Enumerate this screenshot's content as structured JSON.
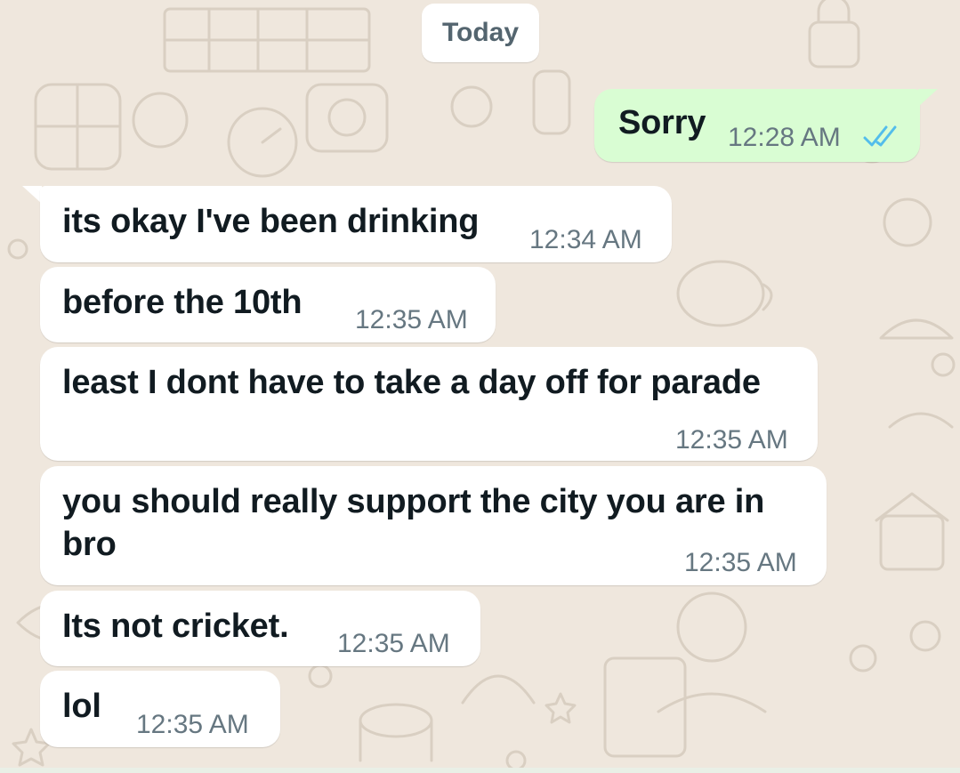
{
  "chat": {
    "date_chip": "Today",
    "messages": [
      {
        "direction": "outgoing",
        "text": "Sorry",
        "time": "12:28 AM",
        "status_icon": "double-check-read-icon"
      },
      {
        "direction": "incoming",
        "text": "its okay I've been drinking",
        "time": "12:34 AM"
      },
      {
        "direction": "incoming",
        "text": "before the 10th",
        "time": "12:35 AM"
      },
      {
        "direction": "incoming",
        "text": "least I dont have to take a day off for parade",
        "time": "12:35 AM"
      },
      {
        "direction": "incoming",
        "text": "you should really support the city you are in bro",
        "time": "12:35 AM"
      },
      {
        "direction": "incoming",
        "text": "Its not cricket.",
        "time": "12:35 AM"
      },
      {
        "direction": "incoming",
        "text": "lol",
        "time": "12:35 AM"
      }
    ]
  },
  "colors": {
    "wallpaper": "#efe7dd",
    "incoming_bubble": "#ffffff",
    "outgoing_bubble": "#d9fdd3",
    "read_tick": "#53bdeb",
    "timestamp": "#667781"
  }
}
